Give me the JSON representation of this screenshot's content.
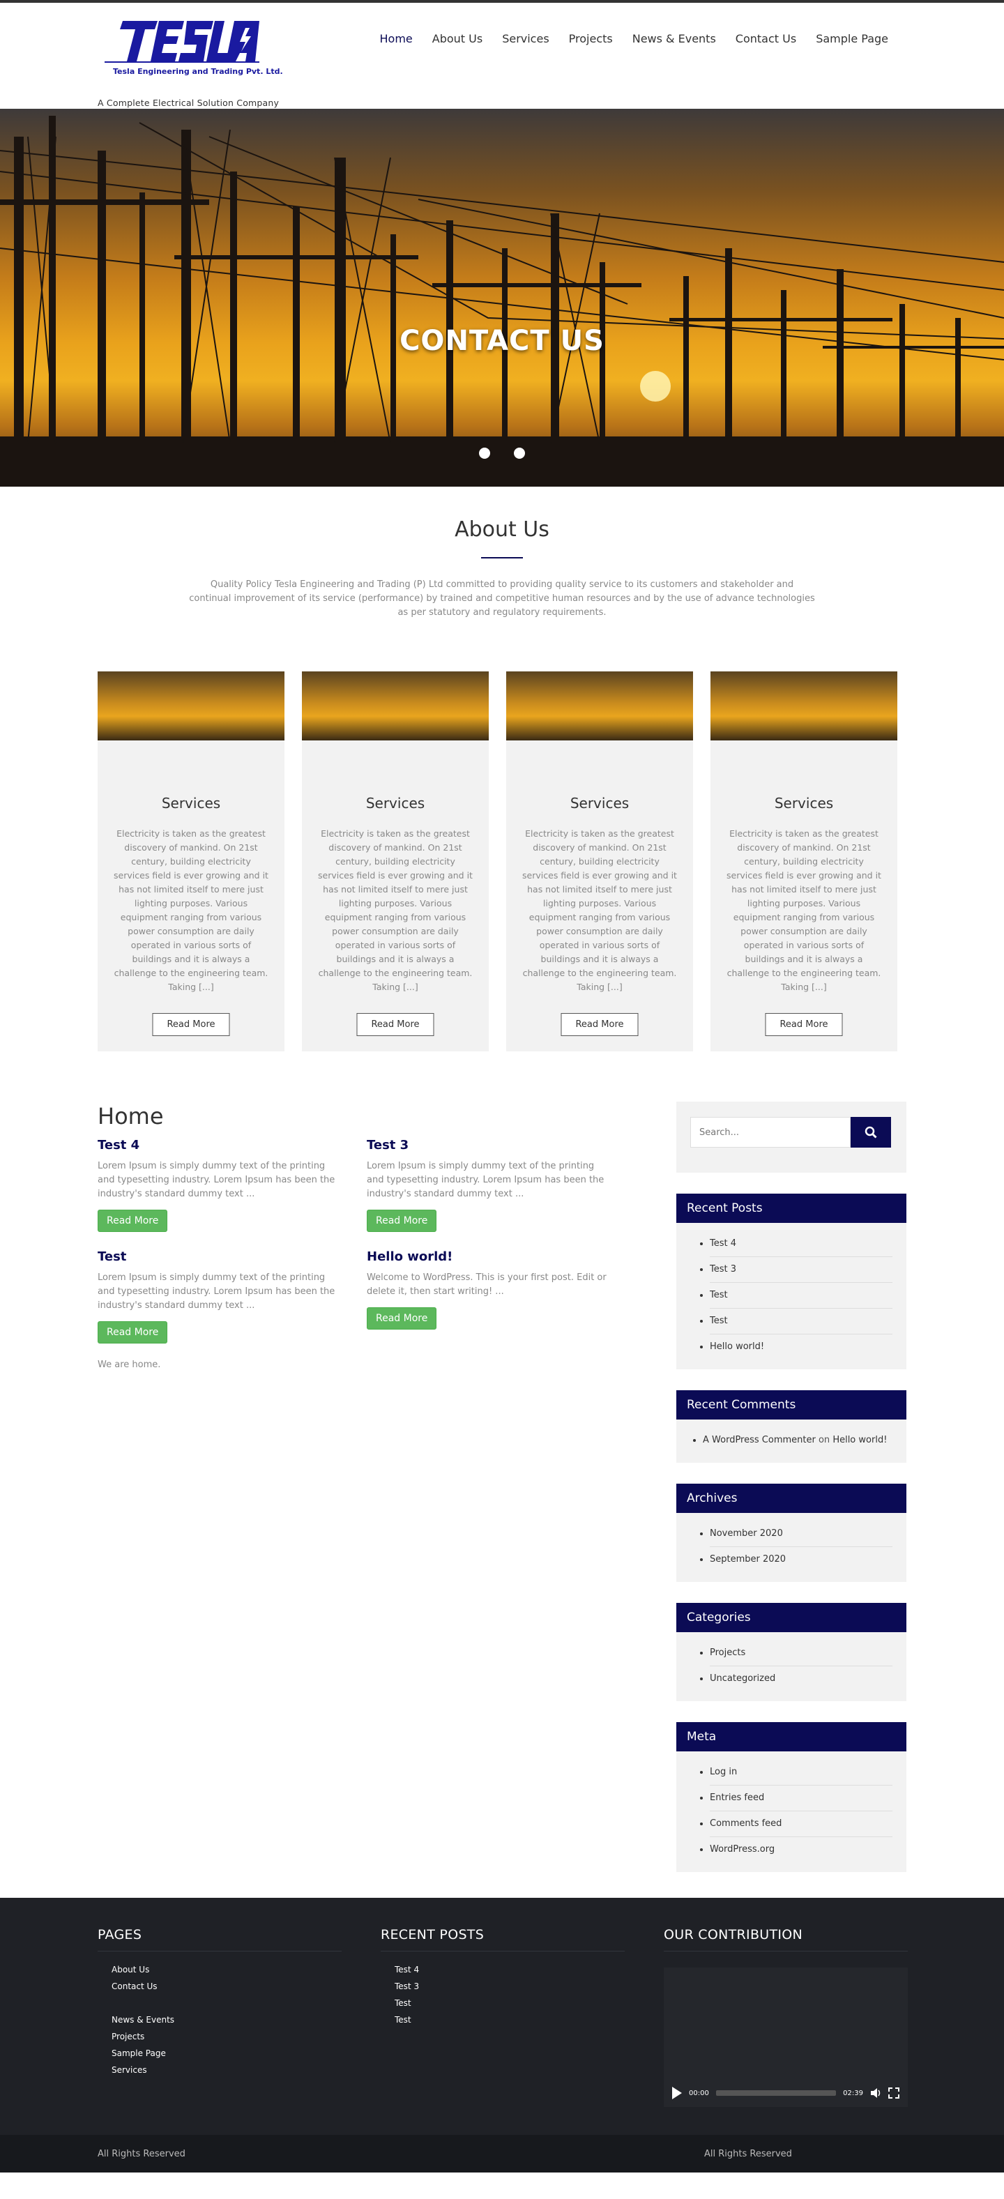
{
  "brand": {
    "logo_text": "TESLA",
    "logo_company": "Tesla Engineering and Trading Pvt. Ltd.",
    "tagline": "A Complete Electrical Solution Company",
    "primary_color": "#0b0b55",
    "accent_color": "#5cb85c"
  },
  "nav": {
    "items": [
      {
        "label": "Home",
        "active": true
      },
      {
        "label": "About Us"
      },
      {
        "label": "Services"
      },
      {
        "label": "Projects"
      },
      {
        "label": "News & Events"
      },
      {
        "label": "Contact Us"
      },
      {
        "label": "Sample Page"
      }
    ]
  },
  "hero": {
    "title": "CONTACT US",
    "slide_count": 2
  },
  "about": {
    "heading": "About Us",
    "text": "Quality Policy Tesla Engineering and Trading (P) Ltd committed to providing quality service to its customers and stakeholder and continual improvement of its service (performance) by trained and competitive human resources and by the use of advance technologies as per statutory and regulatory requirements."
  },
  "services": {
    "cards": [
      {
        "title": "Services",
        "text": "Electricity is taken as the greatest discovery of mankind. On 21st century, building electricity services field is ever growing and it has not limited itself to mere just lighting purposes. Various equipment ranging from various power consumption are daily operated in various sorts of buildings and it is always a challenge to the engineering team. Taking [...]",
        "button": "Read More"
      },
      {
        "title": "Services",
        "text": "Electricity is taken as the greatest discovery of mankind. On 21st century, building electricity services field is ever growing and it has not limited itself to mere just lighting purposes. Various equipment ranging from various power consumption are daily operated in various sorts of buildings and it is always a challenge to the engineering team. Taking [...]",
        "button": "Read More"
      },
      {
        "title": "Services",
        "text": "Electricity is taken as the greatest discovery of mankind. On 21st century, building electricity services field is ever growing and it has not limited itself to mere just lighting purposes. Various equipment ranging from various power consumption are daily operated in various sorts of buildings and it is always a challenge to the engineering team. Taking [...]",
        "button": "Read More"
      },
      {
        "title": "Services",
        "text": "Electricity is taken as the greatest discovery of mankind. On 21st century, building electricity services field is ever growing and it has not limited itself to mere just lighting purposes. Various equipment ranging from various power consumption are daily operated in various sorts of buildings and it is always a challenge to the engineering team. Taking [...]",
        "button": "Read More"
      }
    ]
  },
  "home": {
    "heading": "Home",
    "posts": [
      {
        "title": "Test 4",
        "excerpt": "Lorem Ipsum is simply dummy text of the printing and typesetting industry. Lorem Ipsum has been the industry's standard dummy text ...",
        "button": "Read More"
      },
      {
        "title": "Test 3",
        "excerpt": "Lorem Ipsum is simply dummy text of the printing and typesetting industry. Lorem Ipsum has been the industry's standard dummy text ...",
        "button": "Read More"
      },
      {
        "title": "Test",
        "excerpt": "Lorem Ipsum is simply dummy text of the printing and typesetting industry. Lorem Ipsum has been the industry's standard dummy text ...",
        "button": "Read More"
      },
      {
        "title": "Hello world!",
        "excerpt": "Welcome to WordPress. This is your first post. Edit or delete it, then start writing! ...",
        "button": "Read More"
      }
    ],
    "note": "We are home."
  },
  "sidebar": {
    "search_placeholder": "Search...",
    "recent_posts": {
      "title": "Recent Posts",
      "items": [
        "Test 4",
        "Test 3",
        "Test",
        "Test",
        "Hello world!"
      ]
    },
    "recent_comments": {
      "title": "Recent Comments",
      "author": "A WordPress Commenter",
      "on": "on",
      "post": "Hello world!"
    },
    "archives": {
      "title": "Archives",
      "items": [
        "November 2020",
        "September 2020"
      ]
    },
    "categories": {
      "title": "Categories",
      "items": [
        "Projects",
        "Uncategorized"
      ]
    },
    "meta": {
      "title": "Meta",
      "items": [
        "Log in",
        "Entries feed",
        "Comments feed",
        "WordPress.org"
      ]
    }
  },
  "footer": {
    "pages": {
      "title": "PAGES",
      "group1": [
        "About Us",
        "Contact Us"
      ],
      "group2": [
        "News & Events",
        "Projects",
        "Sample Page",
        "Services"
      ]
    },
    "recent": {
      "title": "RECENT POSTS",
      "items": [
        "Test 4",
        "Test 3",
        "Test",
        "Test"
      ]
    },
    "contribution": {
      "title": "OUR CONTRIBUTION",
      "time_current": "00:00",
      "time_total": "02:39",
      "progress": 0
    },
    "copyright_left": "All Rights Reserved",
    "copyright_right": "All Rights Reserved"
  }
}
